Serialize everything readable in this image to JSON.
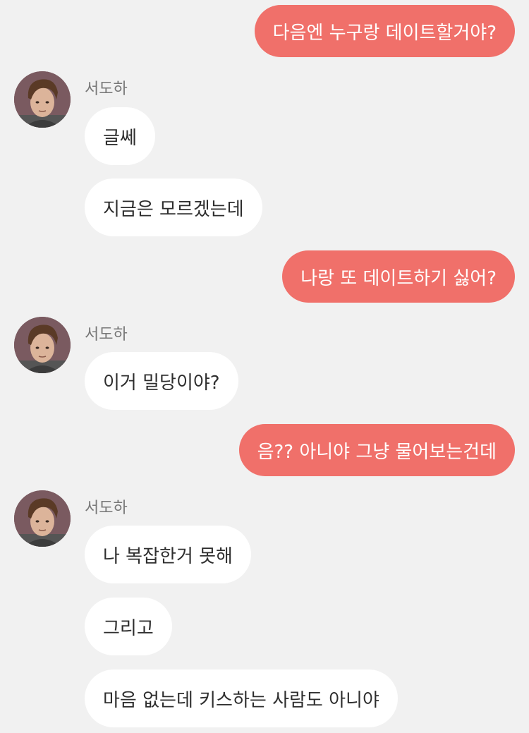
{
  "contact": {
    "name": "서도하",
    "avatar_icon": "person-avatar-icon"
  },
  "colors": {
    "background": "#f1f1f1",
    "my_bubble": "#f0706a",
    "their_bubble": "#ffffff",
    "name_text": "#777777"
  },
  "messages": [
    {
      "sender": "me",
      "text": "다음엔 누구랑 데이트할거야?"
    },
    {
      "sender": "them",
      "text": "글쎄"
    },
    {
      "sender": "them",
      "text": "지금은 모르겠는데"
    },
    {
      "sender": "me",
      "text": "나랑 또 데이트하기 싫어?"
    },
    {
      "sender": "them",
      "text": "이거 밀당이야?"
    },
    {
      "sender": "me",
      "text": "음?? 아니야 그냥 물어보는건데"
    },
    {
      "sender": "them",
      "text": "나 복잡한거 못해"
    },
    {
      "sender": "them",
      "text": "그리고"
    },
    {
      "sender": "them",
      "text": "마음 없는데 키스하는 사람도 아니야"
    }
  ]
}
